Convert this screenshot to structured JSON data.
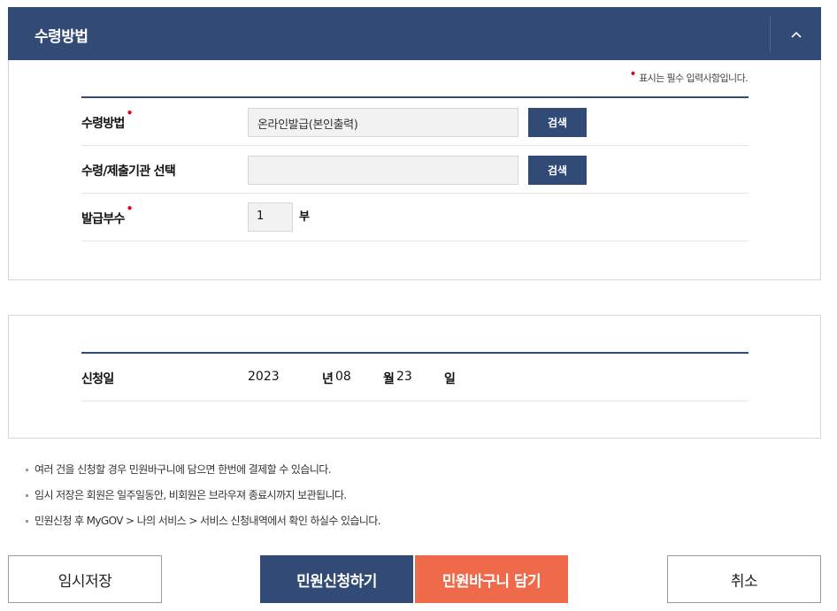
{
  "section": {
    "title": "수령방법"
  },
  "required_note": "표시는 필수 입력사항입니다.",
  "form": {
    "method": {
      "label": "수령방법",
      "value": "온라인발급(본인출력)",
      "search": "검색"
    },
    "agency": {
      "label": "수령/제출기관 선택",
      "value": "",
      "search": "검색"
    },
    "copies": {
      "label": "발급부수",
      "value": "1",
      "unit": "부"
    }
  },
  "apply_date": {
    "label": "신청일",
    "year": "2023",
    "year_unit": "년",
    "month": "08",
    "month_unit": "월",
    "day": "23",
    "day_unit": "일"
  },
  "notes": [
    "여러 건을 신청할 경우 민원바구니에 담으면 한번에 결제할 수 있습니다.",
    "임시 저장은 회원은 일주일동안, 비회원은 브라우져 종료시까지 보관됩니다.",
    "민원신청 후 MyGOV > 나의 서비스 > 서비스 신청내역에서 확인 하실수 있습니다."
  ],
  "buttons": {
    "temp_save": "임시저장",
    "apply": "민원신청하기",
    "basket": "민원바구니 담기",
    "cancel": "취소"
  },
  "colors": {
    "primary": "#314a76",
    "accent": "#ee6a4a",
    "required": "#e60012"
  },
  "icons": {
    "toggle": "chevron-up-icon"
  }
}
